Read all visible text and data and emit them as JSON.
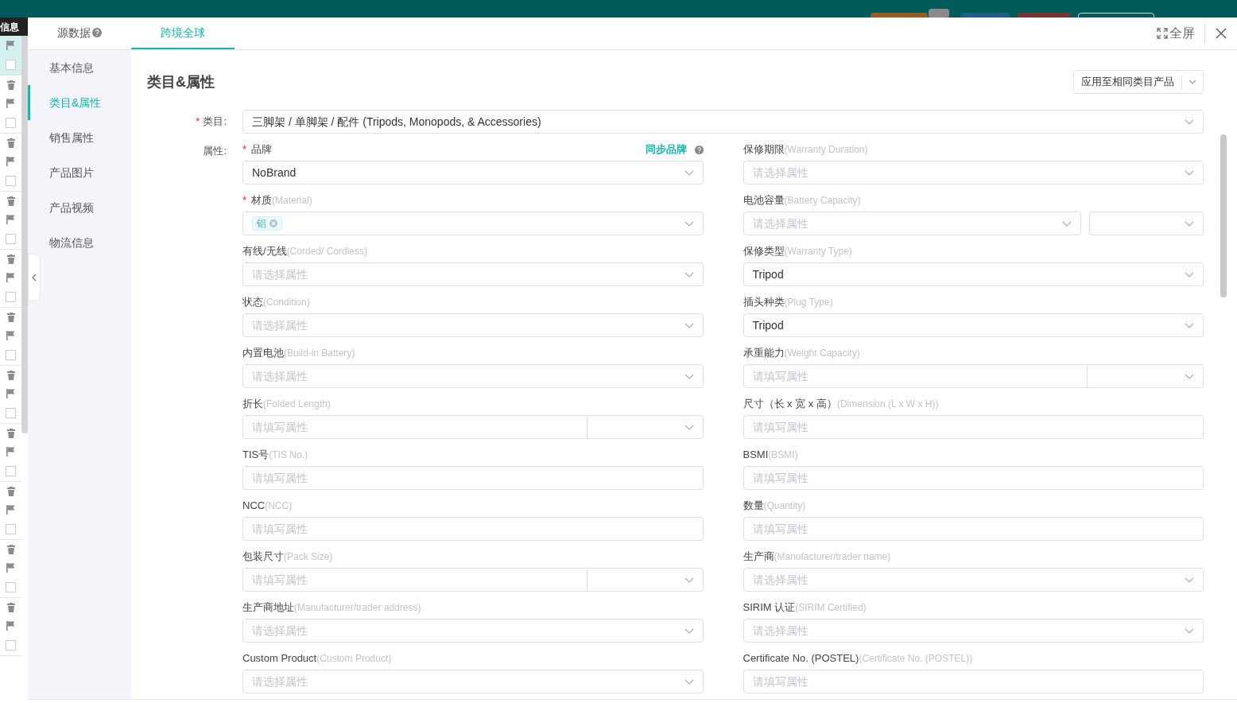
{
  "left_strip": {
    "label": "信息",
    "groups": [
      {
        "selected": true,
        "checked": false
      },
      {
        "selected": false,
        "checked": false
      },
      {
        "selected": false,
        "checked": false
      },
      {
        "selected": false,
        "checked": false
      },
      {
        "selected": false,
        "checked": false
      },
      {
        "selected": false,
        "checked": false
      },
      {
        "selected": false,
        "checked": false
      },
      {
        "selected": false,
        "checked": false
      },
      {
        "selected": false,
        "checked": false
      },
      {
        "selected": false,
        "checked": false
      },
      {
        "selected": false,
        "checked": false
      }
    ]
  },
  "tabs": [
    {
      "label": "源数据",
      "help": true,
      "selected": false
    },
    {
      "label": "跨境全球",
      "help": false,
      "selected": true
    }
  ],
  "header_actions": {
    "fullscreen": "全屏"
  },
  "side_nav": [
    {
      "label": "基本信息",
      "selected": false
    },
    {
      "label": "类目&属性",
      "selected": true
    },
    {
      "label": "销售属性",
      "selected": false
    },
    {
      "label": "产品图片",
      "selected": false
    },
    {
      "label": "产品视频",
      "selected": false
    },
    {
      "label": "物流信息",
      "selected": false
    }
  ],
  "section": {
    "title": "类目&属性",
    "apply_button": "应用至相同类目产品"
  },
  "category": {
    "label": "类目:",
    "required_mark": "*",
    "value": "三脚架 / 单脚架 / 配件 (Tripods, Monopods, & Accessories)"
  },
  "attributes_label": "属性:",
  "attributes": {
    "left": [
      {
        "kind": "select",
        "required_mark": "*",
        "label": "品牌",
        "value": "NoBrand",
        "link": "同步品牌"
      },
      {
        "kind": "select",
        "required_mark": "*",
        "label": "材质",
        "hint": "(Material)",
        "tags": [
          "铝"
        ]
      },
      {
        "kind": "select",
        "label": "有线/无线",
        "hint": "(Corded/ Cordless)",
        "placeholder": "请选择属性"
      },
      {
        "kind": "select",
        "label": "状态",
        "hint": "(Condition)",
        "placeholder": "请选择属性"
      },
      {
        "kind": "select",
        "label": "内置电池",
        "hint": "(Build-in Battery)",
        "placeholder": "请选择属性"
      },
      {
        "kind": "input_unit",
        "label": "折长",
        "hint": "(Folded Length)",
        "placeholder": "请填写属性"
      },
      {
        "kind": "input",
        "label": "TIS号",
        "hint": "(TIS No.)",
        "placeholder": "请填写属性"
      },
      {
        "kind": "input",
        "label": "NCC",
        "hint": "(NCC)",
        "placeholder": "请填写属性"
      },
      {
        "kind": "input_unit",
        "label": "包装尺寸",
        "hint": "(Pack Size)",
        "placeholder": "请填写属性"
      },
      {
        "kind": "select",
        "label": "生产商地址",
        "hint": "(Manufacturer/trader address)",
        "placeholder": "请选择属性"
      },
      {
        "kind": "select",
        "label": "Custom Product",
        "hint": "(Custom Product)",
        "placeholder": "请选择属性"
      }
    ],
    "right": [
      {
        "kind": "select",
        "label": "保修期限",
        "hint": "(Warranty Duration)",
        "placeholder": "请选择属性"
      },
      {
        "kind": "select_unit",
        "label": "电池容量",
        "hint": "(Battery Capacity)",
        "placeholder": "请选择属性"
      },
      {
        "kind": "select",
        "label": "保修类型",
        "hint": "(Warranty Type)",
        "value": "Tripod"
      },
      {
        "kind": "select",
        "label": "插头种类",
        "hint": "(Plug Type)",
        "value": "Tripod"
      },
      {
        "kind": "input_unit",
        "label": "承重能力",
        "hint": "(Weight Capacity)",
        "placeholder": "请填写属性"
      },
      {
        "kind": "input",
        "label": "尺寸（长 x 宽 x 高）",
        "hint": "(Dimension (L x W x H))",
        "placeholder": "请填写属性"
      },
      {
        "kind": "input",
        "label": "BSMI",
        "hint": "(BSMI)",
        "placeholder": "请填写属性"
      },
      {
        "kind": "input",
        "label": "数量",
        "hint": "(Quantity)",
        "placeholder": "请填写属性"
      },
      {
        "kind": "select",
        "label": "生产商",
        "hint": "(Manufacturer/trader name)",
        "placeholder": "请选择属性"
      },
      {
        "kind": "select",
        "label": "SIRIM 认证",
        "hint": "(SIRIM Certified)",
        "placeholder": "请选择属性"
      },
      {
        "kind": "input",
        "label": "Certificate No. (POSTEL)",
        "hint": "(Certificate No. (POSTEL))",
        "placeholder": "请填写属性"
      }
    ]
  }
}
